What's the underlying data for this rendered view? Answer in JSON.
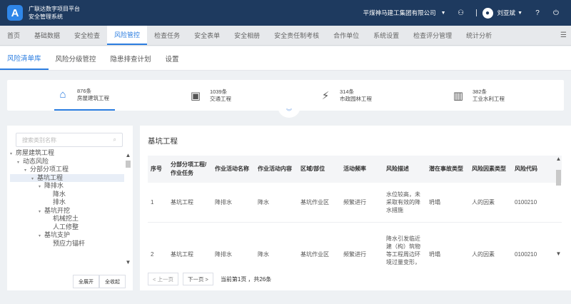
{
  "header": {
    "logo_letter": "A",
    "app_title_line1": "广联达数字项目平台",
    "app_title_line2": "安全管理系统",
    "company": "平煤神马建工集团有限公司",
    "user": "刘亚斌",
    "icons": [
      "user-group-icon",
      "avatar-icon",
      "help-icon"
    ]
  },
  "mainnav": {
    "items": [
      "首页",
      "基础数据",
      "安全检查",
      "风险管控",
      "检查任务",
      "安全表单",
      "安全相册",
      "安全责任制考核",
      "合作单位",
      "系统设置",
      "检查评分管理",
      "统计分析"
    ],
    "active_index": 3
  },
  "subtabs": {
    "items": [
      "风险清单库",
      "风险分级管控",
      "隐患排查计划",
      "设置"
    ],
    "active_index": 0
  },
  "categories": [
    {
      "count": "876条",
      "name": "房屋建筑工程",
      "icon": "house-icon"
    },
    {
      "count": "1039条",
      "name": "交通工程",
      "icon": "bus-icon"
    },
    {
      "count": "314条",
      "name": "市政园林工程",
      "icon": "municipal-icon"
    },
    {
      "count": "382条",
      "name": "工业水利工程",
      "icon": "dam-icon"
    }
  ],
  "tree": {
    "search_placeholder": "搜索类别名称",
    "nodes": [
      {
        "label": "房屋建筑工程",
        "toggle": "▾",
        "level": 0
      },
      {
        "label": "动态风险",
        "toggle": "▾",
        "level": 1
      },
      {
        "label": "分部分项工程",
        "toggle": "▾",
        "level": 2
      },
      {
        "label": "基坑工程",
        "toggle": "▾",
        "level": 3,
        "selected": true
      },
      {
        "label": "降排水",
        "toggle": "▾",
        "level": 4
      },
      {
        "label": "降水",
        "toggle": "",
        "level": 5
      },
      {
        "label": "排水",
        "toggle": "",
        "level": 5
      },
      {
        "label": "基坑开挖",
        "toggle": "▾",
        "level": 4
      },
      {
        "label": "机械挖土",
        "toggle": "",
        "level": 5
      },
      {
        "label": "人工修整",
        "toggle": "",
        "level": 5
      },
      {
        "label": "基坑支护",
        "toggle": "▾",
        "level": 4
      },
      {
        "label": "预应力锚杆",
        "toggle": "",
        "level": 5
      }
    ],
    "expand_all": "全展开",
    "collapse_all": "全收起"
  },
  "content": {
    "title": "基坑工程",
    "columns": [
      "序号",
      "分部分项工程/作业任务",
      "作业活动名称",
      "作业活动内容",
      "区域/部位",
      "活动频率",
      "风险描述",
      "潜在事故类型",
      "风险因素类型",
      "风险代码"
    ],
    "rows": [
      [
        "1",
        "基坑工程",
        "降排水",
        "降水",
        "基坑作业区",
        "频繁进行",
        "水位较高，未采取有效的降水措施",
        "坍塌",
        "人的因素",
        "0100210"
      ],
      [
        "2",
        "基坑工程",
        "降排水",
        "降水",
        "基坑作业区",
        "频繁进行",
        "降水引发临近建（构）筑物等工程周边环境过量变形，产生沉降裂缝",
        "坍塌",
        "人的因素",
        "0100210"
      ]
    ]
  },
  "pager": {
    "prev": "< 上一页",
    "next": "下一页 >",
    "current": "当前第1页",
    "total": "，共26条"
  }
}
